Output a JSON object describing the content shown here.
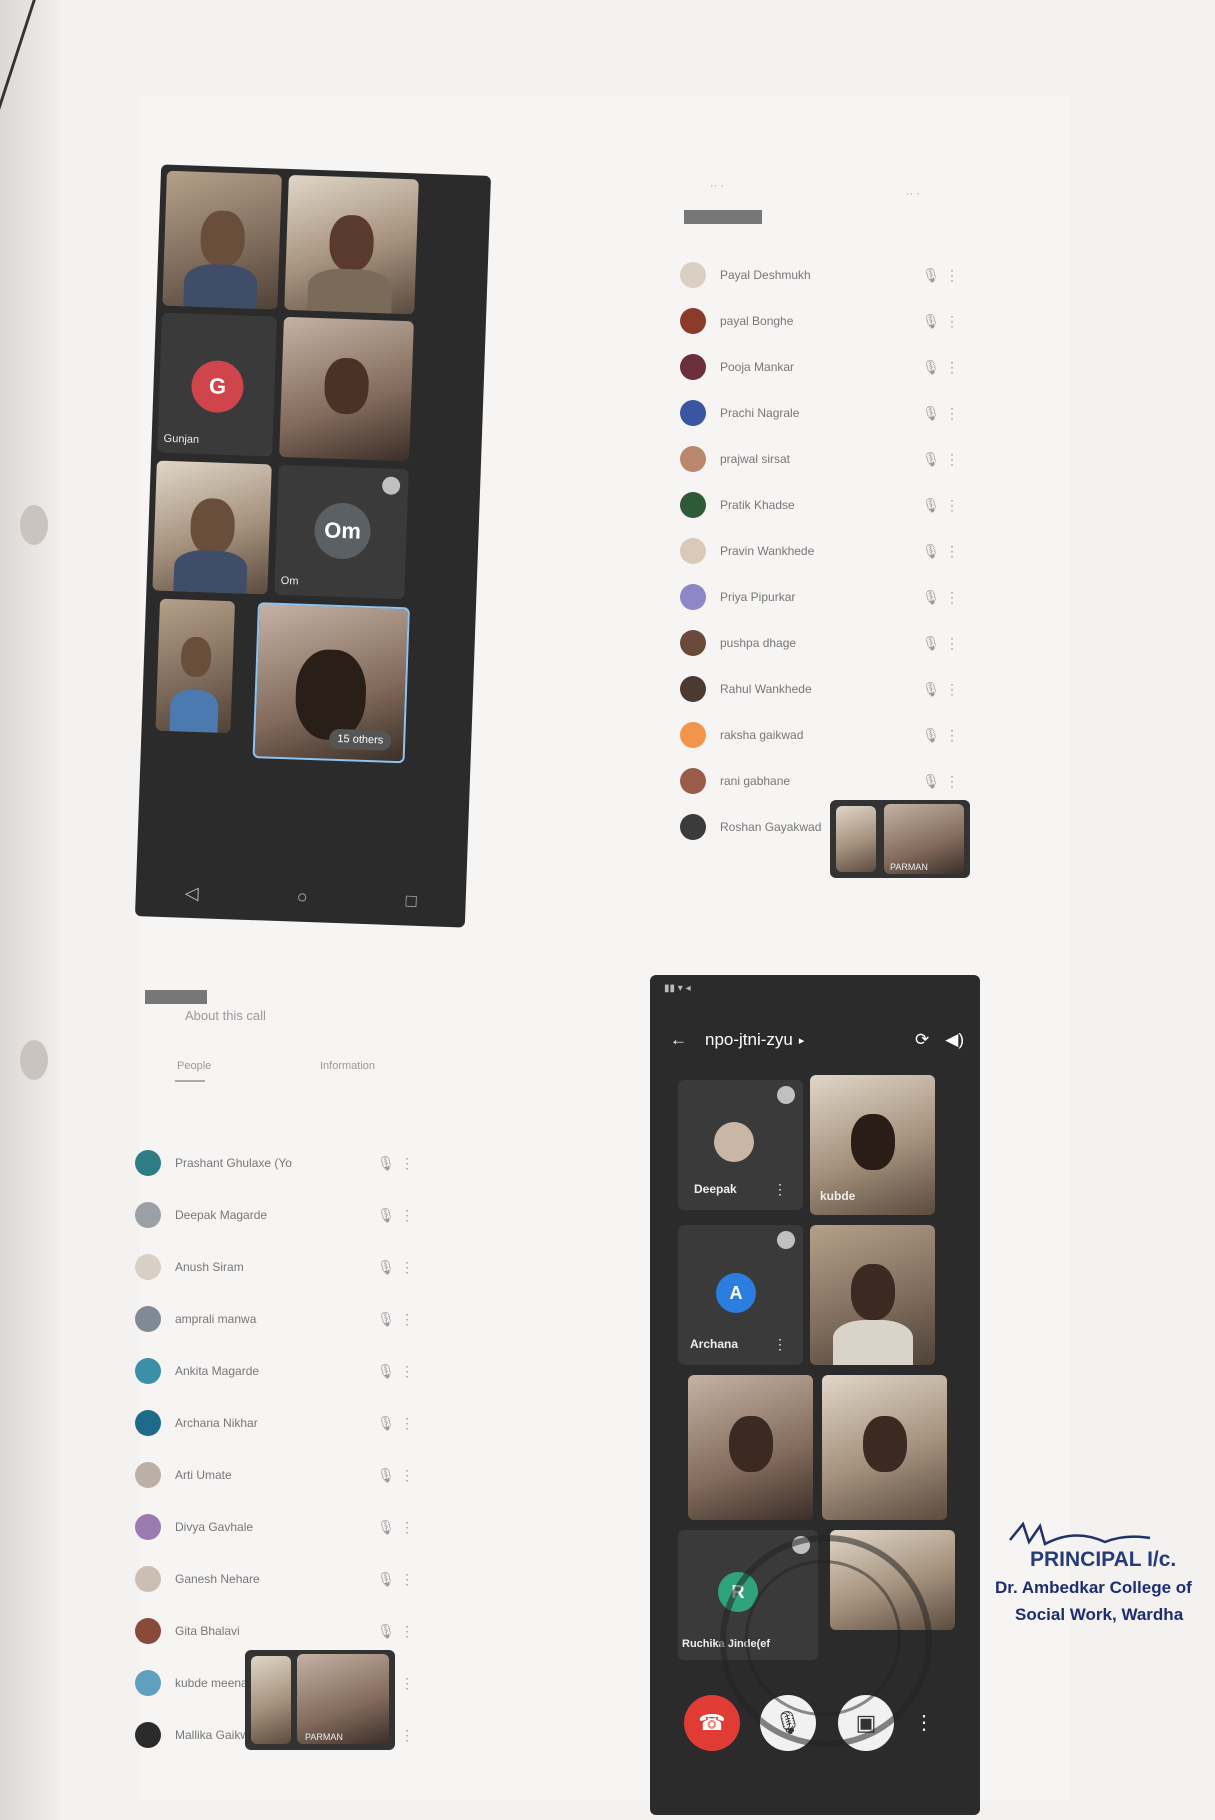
{
  "phone1": {
    "tile_names": [
      "Gunjan",
      "Om"
    ],
    "avatars": [
      {
        "letter": "G",
        "color": "#d0454c"
      },
      {
        "letter": "Om",
        "color": "#5a6063"
      }
    ],
    "others_badge": "15 others",
    "nav_icons": [
      "◁",
      "○",
      "□"
    ]
  },
  "list1": {
    "participants": [
      {
        "name": "Payal Deshmukh",
        "color": "#d9cfc2"
      },
      {
        "name": "payal Bonghe",
        "color": "#8b3b2b"
      },
      {
        "name": "Pooja Mankar",
        "color": "#6b2e3b"
      },
      {
        "name": "Prachi Nagrale",
        "color": "#3b56a0"
      },
      {
        "name": "prajwal sirsat",
        "color": "#b9876b"
      },
      {
        "name": "Pratik Khadse",
        "color": "#2f5a3a"
      },
      {
        "name": "Pravin Wankhede",
        "color": "#d8c9b8"
      },
      {
        "name": "Priya Pipurkar",
        "color": "#8e86c7"
      },
      {
        "name": "pushpa dhage",
        "color": "#6a4a3a"
      },
      {
        "name": "Rahul Wankhede",
        "color": "#4c3a30"
      },
      {
        "name": "raksha gaikwad",
        "color": "#f2954a"
      },
      {
        "name": "rani gabhane",
        "color": "#9b5b4b"
      },
      {
        "name": "Roshan Gayakwad",
        "color": "#3b3b3b"
      }
    ],
    "pip_label": "PARMAN"
  },
  "list2": {
    "header": "About this call",
    "tabs": [
      "People",
      "Information"
    ],
    "participants": [
      {
        "name": "Prashant Ghulaxe (Yo",
        "color": "#2f7d84"
      },
      {
        "name": "Deepak Magarde",
        "color": "#9aa0a6"
      },
      {
        "name": "Anush Siram",
        "color": "#d8cfc5"
      },
      {
        "name": "amprali manwa",
        "color": "#7f8a96"
      },
      {
        "name": "Ankita Magarde",
        "color": "#3b8fa6"
      },
      {
        "name": "Archana Nikhar",
        "color": "#1e6a8a"
      },
      {
        "name": "Arti Umate",
        "color": "#bcb0a6"
      },
      {
        "name": "Divya Gavhale",
        "color": "#9a7ab0"
      },
      {
        "name": "Ganesh Nehare",
        "color": "#cbbfb3"
      },
      {
        "name": "Gita Bhalavi",
        "color": "#8a4a3a"
      },
      {
        "name": "kubde meenak",
        "color": "#5fa0c0"
      },
      {
        "name": "Mallika Gaikwad",
        "color": "#2b2b2b"
      }
    ],
    "pip_label": "PARMAN"
  },
  "phone2": {
    "meeting_code": "npo-jtni-zyu",
    "tiles": [
      {
        "name": "Deepak"
      },
      {
        "name": "kubde"
      },
      {
        "name": "Archana",
        "letter": "A",
        "color": "#2b7de0"
      },
      {
        "name": "Ruchika Jinde(ef",
        "letter": "R",
        "color": "#2fa37a"
      }
    ],
    "controls_color": {
      "end": "#e03b34",
      "btn": "#f1f1f1"
    }
  },
  "stamp": {
    "text": "College of Social Work WARDHA"
  },
  "signature": {
    "title": "PRINCIPAL I/c.",
    "college": "Dr. Ambedkar College of",
    "place": "Social Work, Wardha"
  }
}
